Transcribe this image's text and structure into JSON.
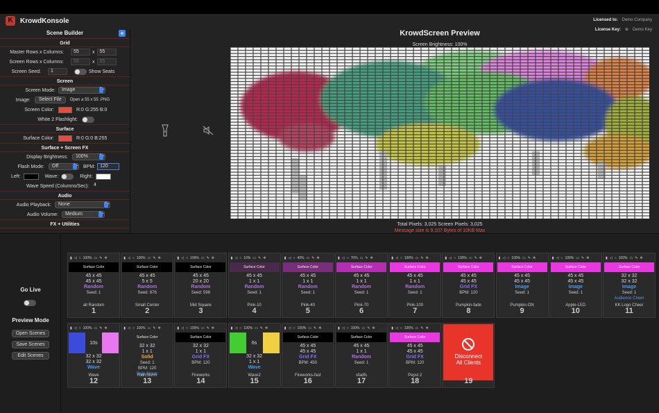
{
  "app": {
    "title": "KrowdKonsole",
    "logo_letter": "K",
    "licensed_to_label": "Licensed to:",
    "licensed_to": "Demo Company",
    "license_key_label": "License Key:",
    "license_key": "Demo Key"
  },
  "scene_builder": {
    "title": "Scene Builder",
    "add_label": "+",
    "grid": {
      "header": "Grid",
      "master_label": "Master Rows x Columns:",
      "master_rows": "55",
      "master_cols": "55",
      "screen_label": "Screen Rows x Columns:",
      "screen_rows": "55",
      "screen_cols": "55",
      "x": "x",
      "seed_label": "Screen Seed:",
      "seed": "1",
      "show_seats": "Show Seats"
    },
    "screen": {
      "header": "Screen",
      "mode_label": "Screen Mode:",
      "mode": "Image",
      "image_label": "Image:",
      "select_file": "Select File",
      "image_hint": "Open a 55 x 55 .PNG",
      "color_label": "Screen Color:",
      "color_value": "R:0 G:255 B:0",
      "color": "#e74c3c",
      "flash_label": "White 2 Flashlight:"
    },
    "surface": {
      "header": "Surface",
      "color_label": "Surface Color:",
      "color_value": "R:0 G:0 B:255",
      "color": "#e74c3c"
    },
    "fx": {
      "header": "Surface + Screen FX",
      "brightness_label": "Display Brightness:",
      "brightness": "100%",
      "flash_label": "Flash Mode:",
      "flash": "Off",
      "bpm_label": "BPM:",
      "bpm": "120",
      "left_label": "Left:",
      "wave_label": "Wave:",
      "right_label": "Right:",
      "wave_speed_label": "Wave Speed (Columns/Sec):",
      "wave_speed": "4"
    },
    "audio": {
      "header": "Audio",
      "playback_label": "Audio Playback:",
      "playback": "None",
      "volume_label": "Audio Volume:",
      "volume": "Medium"
    },
    "next_header": "FX + Utilities"
  },
  "preview": {
    "title": "KrowdScreen Preview",
    "brightness": "Screen Brightness: 100%",
    "total": "Total Pixels: 3,025     Screen Pixels: 3,025",
    "message": "Message size is 9,107 Bytes of 10KB Max"
  },
  "controls": {
    "go_live": "Go Live",
    "preview_mode": "Preview Mode",
    "open": "Open Scenes",
    "save": "Save Scenes",
    "edit": "Edit Scenes"
  },
  "scenes": [
    {
      "num": "1",
      "name": "all Random",
      "pct": "100%",
      "bar": "Surface Color",
      "barcolor": "#000000",
      "l1": "45 x 45",
      "l2": "45 x 45",
      "mode": "Random",
      "modecolor": "#b06ee0",
      "extra": "Seed: 1"
    },
    {
      "num": "2",
      "name": "Small Center",
      "pct": "100%",
      "bar": "Surface Color",
      "barcolor": "#000000",
      "l1": "45 x 45",
      "l2": "5 x 5",
      "mode": "Random",
      "modecolor": "#b06ee0",
      "extra": "Seed: 876"
    },
    {
      "num": "3",
      "name": "Mid Square",
      "pct": "100%",
      "bar": "Surface Color",
      "barcolor": "#000000",
      "l1": "45 x 45",
      "l2": "20 x 20",
      "mode": "Random",
      "modecolor": "#b06ee0",
      "extra": "Seed: 598"
    },
    {
      "num": "4",
      "name": "Pink-10",
      "pct": "10%",
      "bar": "Surface Color",
      "barcolor": "#4a2a4a",
      "l1": "45 x 45",
      "l2": "1 x 1",
      "mode": "Random",
      "modecolor": "#b06ee0",
      "extra": "Seed: 1"
    },
    {
      "num": "5",
      "name": "Pink-40",
      "pct": "40%",
      "bar": "Surface Color",
      "barcolor": "#7a2d7a",
      "l1": "45 x 45",
      "l2": "1 x 1",
      "mode": "Random",
      "modecolor": "#b06ee0",
      "extra": "Seed: 1"
    },
    {
      "num": "6",
      "name": "Pink-70",
      "pct": "70%",
      "bar": "Surface Color",
      "barcolor": "#b22fb2",
      "l1": "45 x 45",
      "l2": "1 x 1",
      "mode": "Random",
      "modecolor": "#b06ee0",
      "extra": "Seed: 1"
    },
    {
      "num": "7",
      "name": "Pink-100",
      "pct": "100%",
      "bar": "Surface Color",
      "barcolor": "#e838e0",
      "l1": "45 x 45",
      "l2": "1 x 1",
      "mode": "Random",
      "modecolor": "#b06ee0",
      "extra": "Seed: 1"
    },
    {
      "num": "8",
      "name": "Pumpkin-fade",
      "pct": "100%",
      "bar": "Surface Color",
      "barcolor": "#e838e0",
      "l1": "45 x 45",
      "l2": "45 x 45",
      "mode": "Grid FX",
      "modecolor": "#8a6ef0",
      "extra": "BPM: 120"
    },
    {
      "num": "9",
      "name": "Pumpkin-ON",
      "pct": "100%",
      "bar": "Surface Color",
      "barcolor": "#e838e0",
      "l1": "45 x 45",
      "l2": "45 x 45",
      "mode": "Image",
      "modecolor": "#4a9af0",
      "extra": "Seed: 1"
    },
    {
      "num": "10",
      "name": "Apple-LED",
      "pct": "100%",
      "bar": "Surface Color",
      "barcolor": "#e838e0",
      "l1": "45 x 45",
      "l2": "45 x 45",
      "mode": "Image",
      "modecolor": "#4a9af0",
      "extra": "Seed: 1"
    },
    {
      "num": "11",
      "name": "KK Logo Cheer",
      "pct": "100%",
      "bar": "Surface Color",
      "barcolor": "#e838e0",
      "l1": "32 x 32",
      "l2": "32 x 32",
      "mode": "Image",
      "modecolor": "#4a9af0",
      "extra": "Seed: 1",
      "extra2": "Audience Cheer"
    },
    {
      "num": "12",
      "name": "Wave",
      "pct": "100%",
      "l1": "32 x 32",
      "l2": "32 x 32",
      "mode": "Wave",
      "modecolor": "#4a9af0",
      "extra": "",
      "wave": {
        "left": "#3b4bdb",
        "right": "#e878f0",
        "secs": "10s"
      }
    },
    {
      "num": "13",
      "name": "RainStorm",
      "pct": "100%",
      "bar": "Surface Color",
      "barcolor": "#2a2a2a",
      "l1": "32 x 32",
      "l2": "1 x 1",
      "mode": "Solid",
      "modecolor": "#e8b030",
      "extra": "Seed: 1",
      "extra3": "BPM: 120",
      "extra2": "Rain Storm"
    },
    {
      "num": "14",
      "name": "Fireworks",
      "pct": "100%",
      "bar": "Surface Color",
      "barcolor": "#000000",
      "l1": "32 x 32",
      "l2": "1 x 1",
      "mode": "Grid FX",
      "modecolor": "#8a6ef0",
      "extra": "BPM: 120"
    },
    {
      "num": "15",
      "name": "Wave2",
      "pct": "100%",
      "l1": "32 x 32",
      "l2": "1 x 1",
      "mode": "Wave",
      "modecolor": "#4a9af0",
      "extra": "",
      "wave": {
        "left": "#44cc33",
        "right": "#f0d040",
        "secs": "6s"
      }
    },
    {
      "num": "16",
      "name": "Fireworks-fast",
      "pct": "100%",
      "bar": "Surface Color",
      "barcolor": "#000000",
      "l1": "45 x 45",
      "l2": "45 x 45",
      "mode": "Grid FX",
      "modecolor": "#8a6ef0",
      "extra": "BPM: 450"
    },
    {
      "num": "17",
      "name": "sfadfs",
      "pct": "100%",
      "bar": "Surface Color",
      "barcolor": "#000000",
      "l1": "45 x 45",
      "l2": "1 x 1",
      "mode": "Random",
      "modecolor": "#b06ee0",
      "extra": "Seed: 1"
    },
    {
      "num": "18",
      "name": "Pepsi 2",
      "pct": "100%",
      "bar": "Surface Color",
      "barcolor": "#e838e0",
      "l1": "45 x 45",
      "l2": "45 x 45",
      "mode": "Grid FX",
      "modecolor": "#8a6ef0",
      "extra": "BPM: 120"
    }
  ],
  "disconnect": {
    "num": "19",
    "label1": "Disconnect",
    "label2": "All Clients",
    "color": "#e8342a"
  }
}
